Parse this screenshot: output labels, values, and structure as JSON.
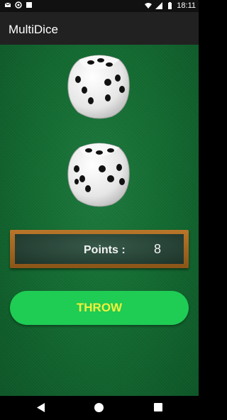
{
  "status_bar": {
    "time": "18:11",
    "icons": [
      "mail-icon",
      "circle-icon",
      "square-icon",
      "wifi-icon",
      "signal-icon",
      "battery-icon"
    ]
  },
  "app_bar": {
    "title": "MultiDice"
  },
  "dice": [
    {
      "value": 5,
      "name": "die-1"
    },
    {
      "value": 6,
      "name": "die-2"
    }
  ],
  "scoreboard": {
    "label": "Points :",
    "value": "8"
  },
  "throw_button": {
    "label": "THROW"
  },
  "colors": {
    "felt": "#136b31",
    "button": "#1fcc54",
    "button_text": "#f2f23a",
    "frame": "#a06420"
  },
  "nav_bar": {
    "icons": [
      "back-icon",
      "home-icon",
      "recents-icon"
    ]
  }
}
